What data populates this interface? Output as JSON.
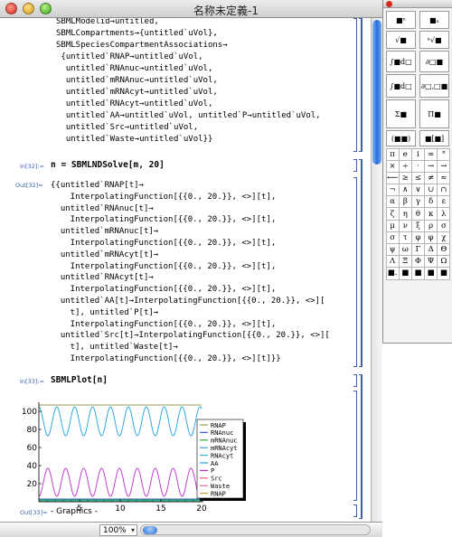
{
  "window": {
    "title": "名称未定義-1"
  },
  "notebook": {
    "top_lines": [
      "SBMLModelid→untitled,",
      "SBMLCompartments→{untitled`uVol},",
      "SBMLSpeciesCompartmentAssociations→",
      " {untitled`RNAP→untitled`uVol,",
      "  untitled`RNAnuc→untitled`uVol,",
      "  untitled`mRNAnuc→untitled`uVol,",
      "  untitled`mRNAcyt→untitled`uVol,",
      "  untitled`RNAcyt→untitled`uVol,",
      "  untitled`AA→untitled`uVol, untitled`P→untitled`uVol,",
      "  untitled`Src→untitled`uVol,",
      "  untitled`Waste→untitled`uVol}}"
    ],
    "in32_label": "In[32]:=",
    "in32_code": "n = SBMLNDSolve[m, 20]",
    "out32_label": "Out[32]=",
    "out32_lines": [
      "{{untitled`RNAP[t]→",
      "    InterpolatingFunction[{{0., 20.}}, <>][t],",
      "  untitled`RNAnuc[t]→",
      "    InterpolatingFunction[{{0., 20.}}, <>][t],",
      "  untitled`mRNAnuc[t]→",
      "    InterpolatingFunction[{{0., 20.}}, <>][t],",
      "  untitled`mRNAcyt[t]→",
      "    InterpolatingFunction[{{0., 20.}}, <>][t],",
      "  untitled`RNAcyt[t]→",
      "    InterpolatingFunction[{{0., 20.}}, <>][t],",
      "  untitled`AA[t]→InterpolatingFunction[{{0., 20.}}, <>][",
      "    t], untitled`P[t]→",
      "    InterpolatingFunction[{{0., 20.}}, <>][t],",
      "  untitled`Src[t]→InterpolatingFunction[{{0., 20.}}, <>][",
      "    t], untitled`Waste[t]→",
      "    InterpolatingFunction[{{0., 20.}}, <>][t]}}"
    ],
    "in33_label": "In[33]:=",
    "in33_code": "SBMLPlot[n]",
    "out33_label": "Out[33]=",
    "out33_value": "- Graphics -"
  },
  "statusbar": {
    "zoom": "100%"
  },
  "palette": {
    "top_buttons": [
      "■ⁿ",
      "■ₙ",
      "√■",
      "ⁿ√■",
      "∫■d□",
      "∂□■",
      "∫■d□",
      "∂□,□■",
      "Σ■",
      "Π■",
      "(■■)",
      "■[■]"
    ],
    "grid_symbols": [
      "π",
      "e",
      "i",
      "∞",
      "°",
      "×",
      "÷",
      "·",
      "→",
      "→",
      "⟵",
      "≥",
      "≤",
      "≠",
      "≈",
      "¬",
      "∧",
      "∨",
      "∪",
      "∩",
      "α",
      "β",
      "γ",
      "δ",
      "ε",
      "ζ",
      "η",
      "θ",
      "κ",
      "λ",
      "μ",
      "ν",
      "ξ",
      "ρ",
      "σ",
      "σ",
      "τ",
      "φ",
      "φ",
      "χ",
      "ψ",
      "ω",
      "Γ",
      "Δ",
      "Θ",
      "Λ",
      "Ξ",
      "Φ",
      "Ψ",
      "Ω",
      "■.",
      "■",
      "■",
      "■",
      "■"
    ]
  },
  "chart_data": {
    "type": "line",
    "title": "",
    "xlabel": "",
    "ylabel": "",
    "xlim": [
      0,
      20
    ],
    "ylim": [
      0,
      110
    ],
    "x_ticks": [
      "5",
      "10",
      "15",
      "20"
    ],
    "y_ticks": [
      "20",
      "40",
      "60",
      "80",
      "100"
    ],
    "legend_position": "right",
    "series": [
      {
        "name": "RNAP",
        "color": "#9aa14c",
        "kind": "const",
        "value": 107
      },
      {
        "name": "RNAnuc",
        "color": "#3d5fd0",
        "kind": "const",
        "value": 3
      },
      {
        "name": "mRNAnuc",
        "color": "#2faa3a",
        "kind": "const",
        "value": 2
      },
      {
        "name": "mRNAcyt",
        "color": "#4a9cc9",
        "kind": "const",
        "value": 1
      },
      {
        "name": "RNAcyt",
        "color": "#2fb8c8",
        "kind": "const",
        "value": 1
      },
      {
        "name": "AA",
        "color": "#1d9fe0",
        "kind": "osc",
        "low": 73,
        "high": 105,
        "period": 2.2,
        "phase": 0.0
      },
      {
        "name": "P",
        "color": "#c02ad1",
        "kind": "osc",
        "low": 6,
        "high": 37,
        "period": 2.2,
        "phase": 1.1
      },
      {
        "name": "Src",
        "color": "#e85a8c",
        "kind": "const",
        "value": 0
      },
      {
        "name": "Waste",
        "color": "#d46aa0",
        "kind": "const",
        "value": 0
      },
      {
        "name": "RNAP",
        "color": "#e09a3a",
        "kind": "const",
        "value": 0
      }
    ]
  }
}
